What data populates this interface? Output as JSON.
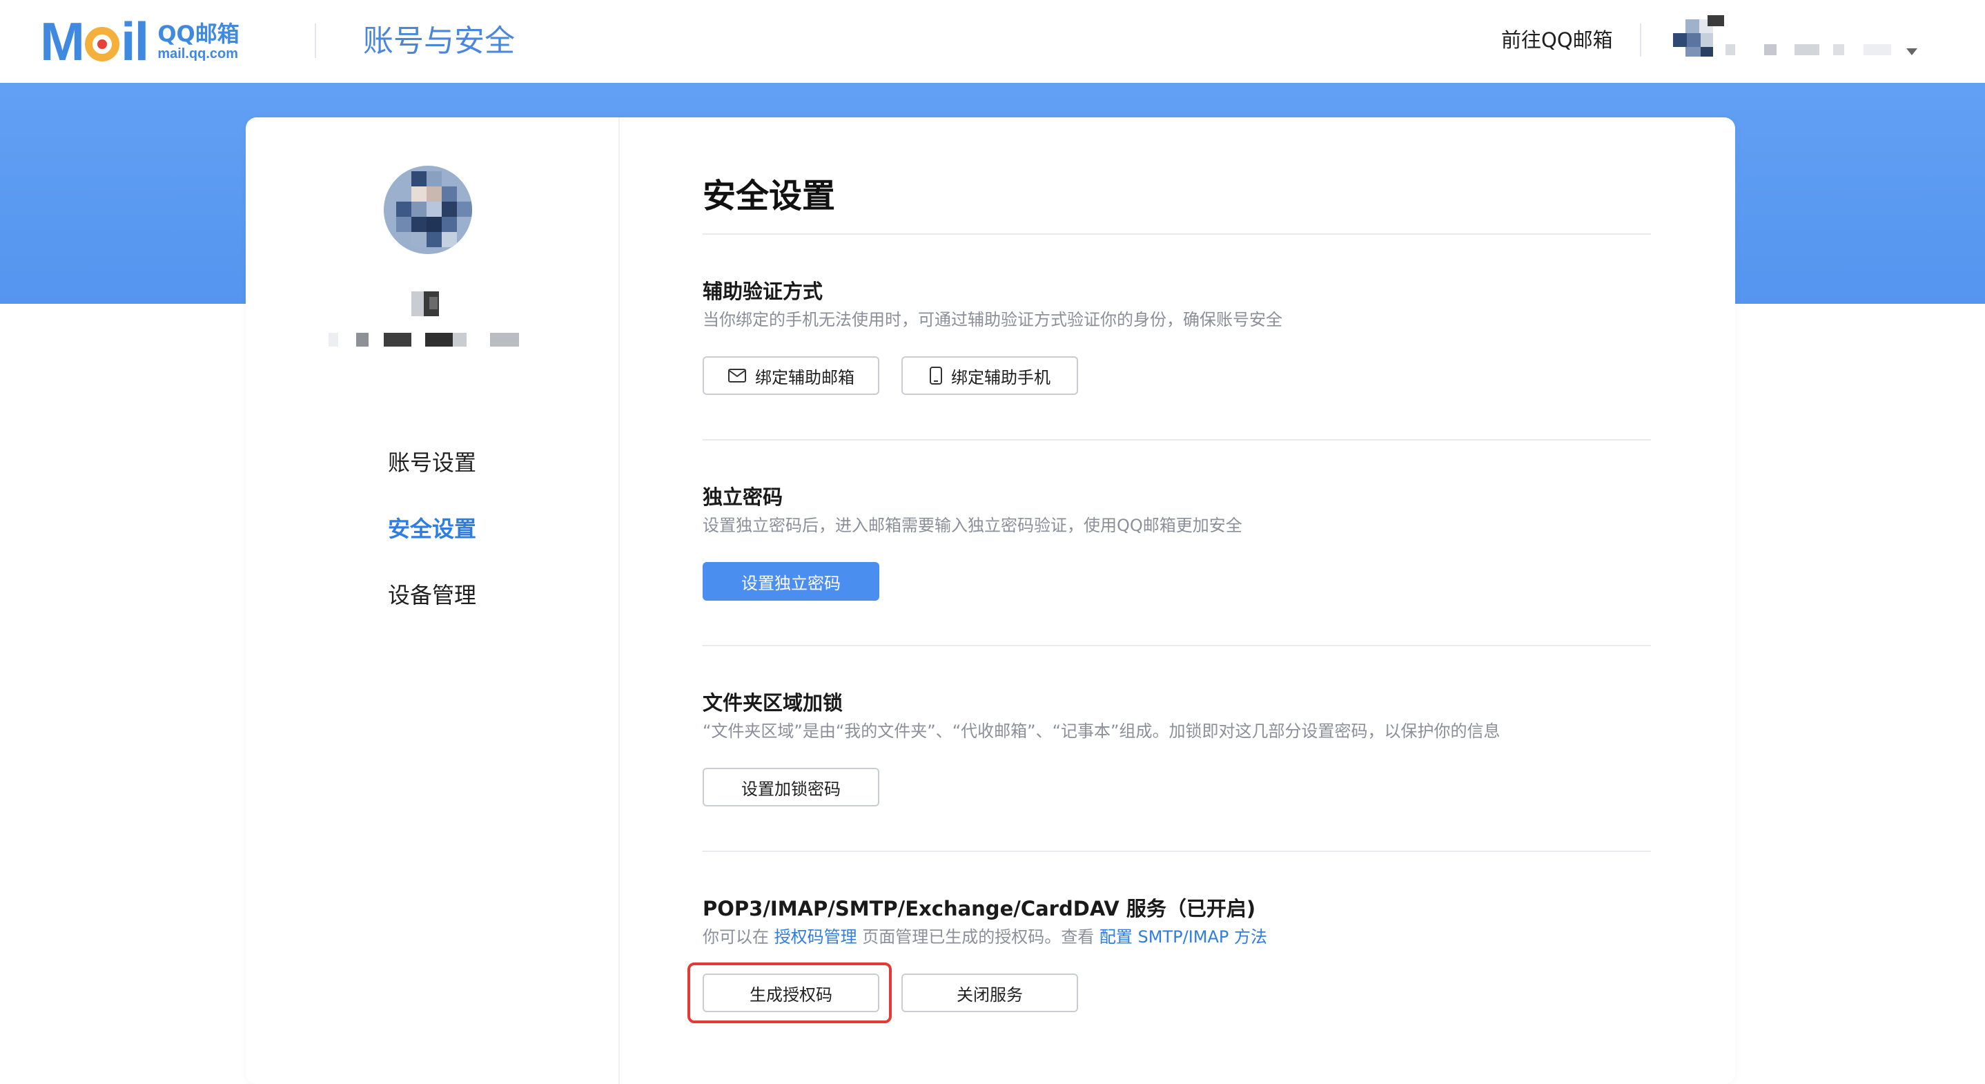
{
  "header": {
    "logo_word": [
      "M",
      "i",
      "l"
    ],
    "logo_cn": "QQ邮箱",
    "logo_url": "mail.qq.com",
    "title": "账号与安全",
    "goto_mail": "前往QQ邮箱"
  },
  "sidebar": {
    "items": [
      {
        "label": "账号设置",
        "active": false
      },
      {
        "label": "安全设置",
        "active": true
      },
      {
        "label": "设备管理",
        "active": false
      }
    ]
  },
  "main": {
    "title": "安全设置",
    "sections": [
      {
        "title": "辅助验证方式",
        "desc": "当你绑定的手机无法使用时，可通过辅助验证方式验证你的身份，确保账号安全",
        "buttons": [
          {
            "label": "绑定辅助邮箱",
            "icon": "mail-icon"
          },
          {
            "label": "绑定辅助手机",
            "icon": "phone-icon"
          }
        ]
      },
      {
        "title": "独立密码",
        "desc": "设置独立密码后，进入邮箱需要输入独立密码验证，使用QQ邮箱更加安全",
        "buttons": [
          {
            "label": "设置独立密码"
          }
        ]
      },
      {
        "title": "文件夹区域加锁",
        "desc": "“文件夹区域”是由“我的文件夹”、“代收邮箱”、“记事本”组成。加锁即对这几部分设置密码，以保护你的信息",
        "buttons": [
          {
            "label": "设置加锁密码"
          }
        ]
      },
      {
        "title": "POP3/IMAP/SMTP/Exchange/CardDAV 服务（已开启)",
        "desc_parts": [
          "你可以在",
          "授权码管理",
          "页面管理已生成的授权码。查看",
          "配置 SMTP/IMAP 方法"
        ],
        "buttons": [
          {
            "label": "生成授权码"
          },
          {
            "label": "关闭服务"
          }
        ]
      }
    ]
  },
  "colors": {
    "accent": "#2e7de0",
    "banner": "#5a99f1",
    "primary_button": "#4a8ef0",
    "highlight_box": "#e53935",
    "desc_text": "#8a8f99"
  }
}
